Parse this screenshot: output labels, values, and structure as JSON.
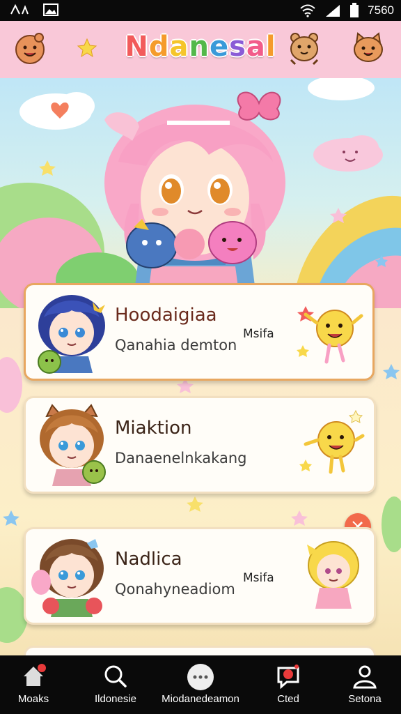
{
  "status_bar": {
    "time": "7560",
    "icons": [
      "network-icon",
      "image-icon",
      "wifi-icon",
      "signal-icon",
      "battery-icon"
    ]
  },
  "header": {
    "title": "Ndanesal",
    "title_colors": [
      "#f25b5b",
      "#f59b2b",
      "#f5c52b",
      "#53b84a",
      "#3a9ad9",
      "#8a5bd6",
      "#f25b8a",
      "#f59b2b"
    ],
    "background": "#f9c8d8"
  },
  "cards": [
    {
      "title": "Hoodaigiaa",
      "subtitle": "Qanahia demton",
      "tag": "Msifa",
      "highlighted": true
    },
    {
      "title": "Miaktion",
      "subtitle": "Danaenelnkakang",
      "tag": "",
      "highlighted": false
    },
    {
      "title": "Nadlica",
      "subtitle": "Qonahyneadiom",
      "tag": "Msifa",
      "highlighted": false
    }
  ],
  "nav": {
    "items": [
      {
        "label": "Moaks",
        "icon": "home-icon",
        "badge": true
      },
      {
        "label": "Ildonesie",
        "icon": "search-icon",
        "badge": false
      },
      {
        "label": "Miodanedeamon",
        "icon": "chat-icon",
        "badge": false
      },
      {
        "label": "Cted",
        "icon": "message-icon",
        "badge": true
      },
      {
        "label": "Setona",
        "icon": "profile-icon",
        "badge": false
      }
    ]
  },
  "colors": {
    "accent": "#f26a4b",
    "card_highlight_border": "#e8a760",
    "nav_background": "#0a0a0a"
  }
}
